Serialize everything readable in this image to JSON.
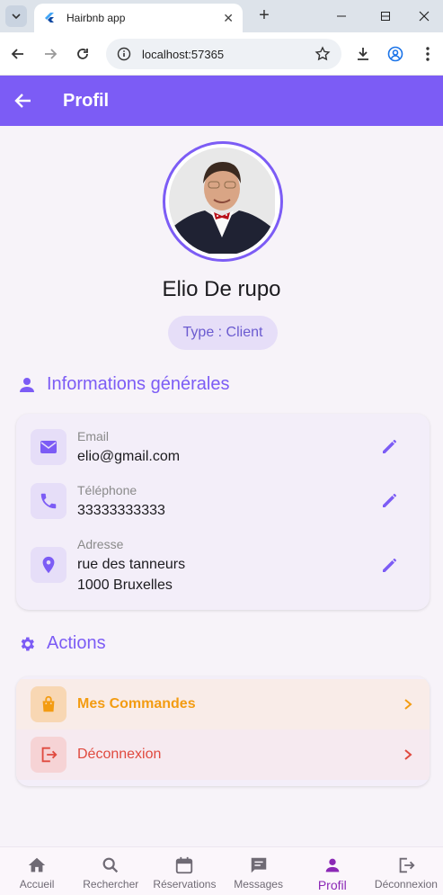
{
  "browser": {
    "tab_title": "Hairbnb app",
    "url": "localhost:57365"
  },
  "appbar": {
    "title": "Profil"
  },
  "profile": {
    "name": "Elio De rupo",
    "type": "Type : Client"
  },
  "general_info": {
    "title": "Informations générales",
    "email_label": "Email",
    "email_value": "elio@gmail.com",
    "phone_label": "Téléphone",
    "phone_value": "33333333333",
    "address_label": "Adresse",
    "address_line1": "rue des tanneurs",
    "address_line2": "1000 Bruxelles"
  },
  "actions": {
    "title": "Actions",
    "orders_label": "Mes Commandes",
    "logout_label": "Déconnexion"
  },
  "bottom_nav": {
    "home": "Accueil",
    "search": "Rechercher",
    "bookings": "Réservations",
    "messages": "Messages",
    "profile": "Profil",
    "logout": "Déconnexion"
  },
  "colors": {
    "primary": "#7c5cf5",
    "orders": "#f39c12",
    "logout": "#e04a3f",
    "active_nav": "#8b28b6"
  }
}
